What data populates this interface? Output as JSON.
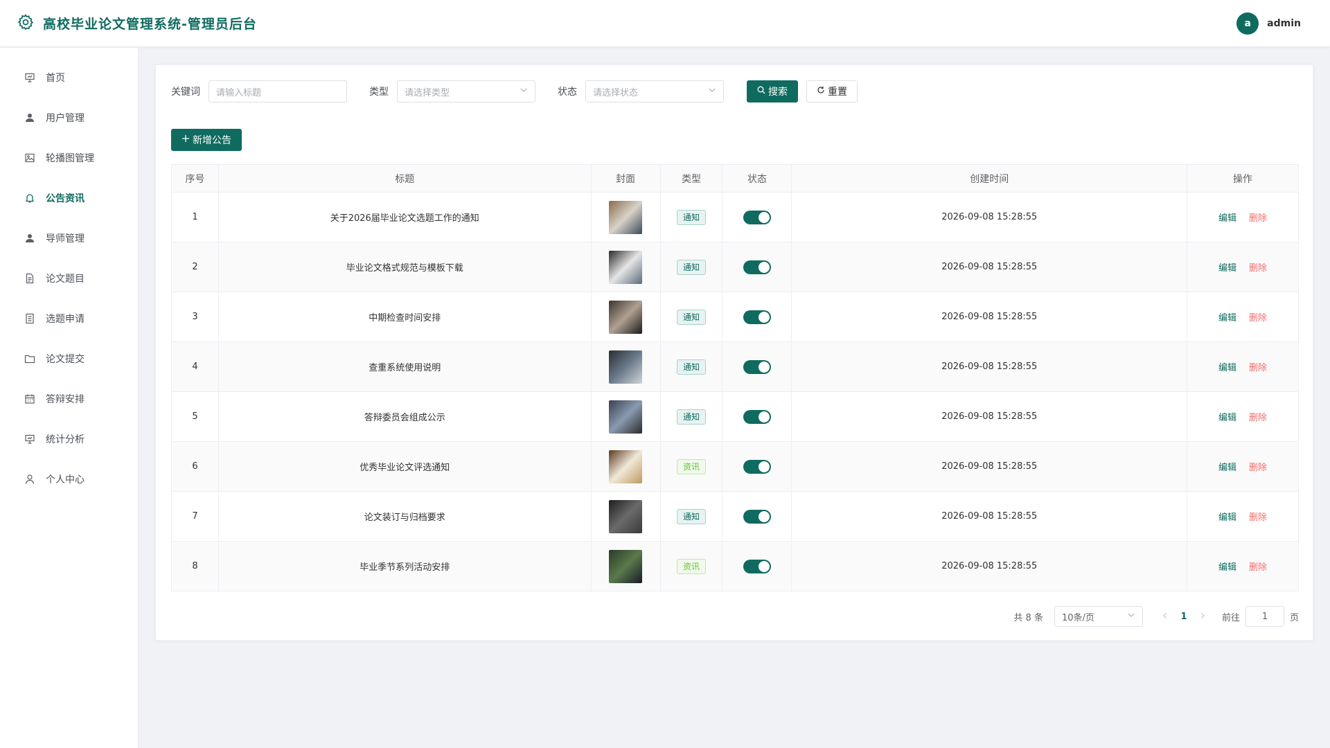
{
  "header": {
    "title": "高校毕业论文管理系统-管理员后台",
    "avatar_letter": "a",
    "username": "admin"
  },
  "sidebar": {
    "items": [
      {
        "label": "首页",
        "icon": "dashboard-icon",
        "active": false
      },
      {
        "label": "用户管理",
        "icon": "user-icon",
        "active": false
      },
      {
        "label": "轮播图管理",
        "icon": "image-icon",
        "active": false
      },
      {
        "label": "公告资讯",
        "icon": "bell-icon",
        "active": true
      },
      {
        "label": "导师管理",
        "icon": "user-icon",
        "active": false
      },
      {
        "label": "论文题目",
        "icon": "document-icon",
        "active": false
      },
      {
        "label": "选题申请",
        "icon": "list-icon",
        "active": false
      },
      {
        "label": "论文提交",
        "icon": "folder-icon",
        "active": false
      },
      {
        "label": "答辩安排",
        "icon": "calendar-icon",
        "active": false
      },
      {
        "label": "统计分析",
        "icon": "chart-icon",
        "active": false
      },
      {
        "label": "个人中心",
        "icon": "person-icon",
        "active": false
      }
    ]
  },
  "filters": {
    "keyword_label": "关键词",
    "keyword_placeholder": "请输入标题",
    "type_label": "类型",
    "type_placeholder": "请选择类型",
    "status_label": "状态",
    "status_placeholder": "请选择状态",
    "search_label": "搜索",
    "reset_label": "重置"
  },
  "add_button": "新增公告",
  "table": {
    "headers": [
      "序号",
      "标题",
      "封面",
      "类型",
      "状态",
      "创建时间",
      "操作"
    ],
    "edit_label": "编辑",
    "delete_label": "删除",
    "rows": [
      {
        "index": "1",
        "title": "关于2026届毕业论文选题工作的通知",
        "type": "通知",
        "type_kind": "notice",
        "status": true,
        "created": "2026-09-08 15:28:55",
        "cover_colors": [
          "#8a6a4a",
          "#d8d2c8",
          "#3a4a5a"
        ]
      },
      {
        "index": "2",
        "title": "毕业论文格式规范与模板下载",
        "type": "通知",
        "type_kind": "notice",
        "status": true,
        "created": "2026-09-08 15:28:55",
        "cover_colors": [
          "#2a2a2a",
          "#e6e6e6",
          "#5a6a7a"
        ]
      },
      {
        "index": "3",
        "title": "中期检查时间安排",
        "type": "通知",
        "type_kind": "notice",
        "status": true,
        "created": "2026-09-08 15:28:55",
        "cover_colors": [
          "#3a3530",
          "#b0a090",
          "#1a1a1a"
        ]
      },
      {
        "index": "4",
        "title": "查重系统使用说明",
        "type": "通知",
        "type_kind": "notice",
        "status": true,
        "created": "2026-09-08 15:28:55",
        "cover_colors": [
          "#2a2e32",
          "#6a7a8a",
          "#d0d4d8"
        ]
      },
      {
        "index": "5",
        "title": "答辩委员会组成公示",
        "type": "通知",
        "type_kind": "notice",
        "status": true,
        "created": "2026-09-08 15:28:55",
        "cover_colors": [
          "#3a4050",
          "#8a9ab0",
          "#2a2a2a"
        ]
      },
      {
        "index": "6",
        "title": "优秀毕业论文评选通知",
        "type": "资讯",
        "type_kind": "news",
        "status": true,
        "created": "2026-09-08 15:28:55",
        "cover_colors": [
          "#5a3a20",
          "#f0e8d8",
          "#c09a60"
        ]
      },
      {
        "index": "7",
        "title": "论文装订与归档要求",
        "type": "通知",
        "type_kind": "notice",
        "status": true,
        "created": "2026-09-08 15:28:55",
        "cover_colors": [
          "#1e1e1e",
          "#6a6a6a",
          "#3a3a3a"
        ]
      },
      {
        "index": "8",
        "title": "毕业季节系列活动安排",
        "type": "资讯",
        "type_kind": "news",
        "status": true,
        "created": "2026-09-08 15:28:55",
        "cover_colors": [
          "#2a3a2a",
          "#5a7a4a",
          "#1a1a2a"
        ]
      }
    ]
  },
  "pagination": {
    "total_text": "共 8 条",
    "page_size": "10条/页",
    "current_page": "1",
    "goto_label": "前往",
    "goto_value": "1",
    "page_suffix": "页"
  },
  "colors": {
    "primary": "#0f6b5f",
    "danger": "#f56c6c",
    "success": "#67c23a"
  }
}
